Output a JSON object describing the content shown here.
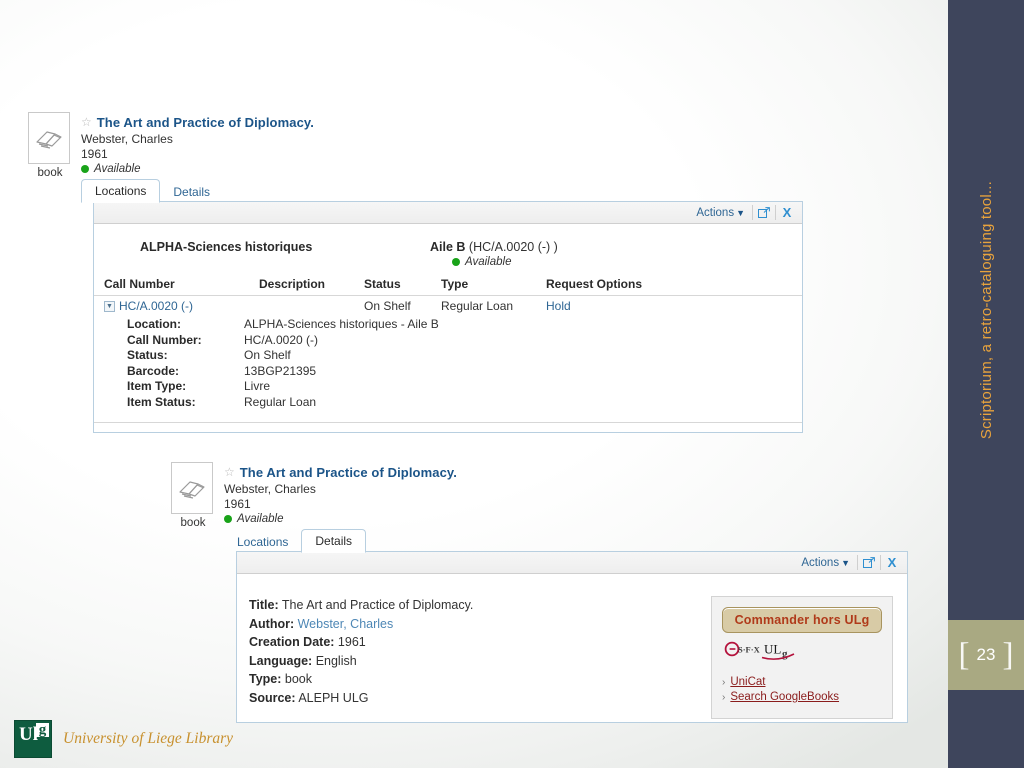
{
  "slide": {
    "vertical_title": "Scriptorium, a retro-cataloguing tool...",
    "page_number": "23",
    "bracket_left": "[",
    "bracket_right": "]",
    "footer_text": "University of Liege Library",
    "logo_letters": {
      "ul": "Ul",
      "g": "g"
    },
    "colors": {
      "sidebar": "#3e455c",
      "page_box": "#a9a982",
      "accent_orange": "#e8a33d",
      "footer_gold": "#c8912f",
      "link_blue": "#2f6694",
      "title_blue": "#1b5488",
      "available_green": "#19a319",
      "order_button_text": "#b03a1a"
    }
  },
  "record": {
    "thumb_label": "book",
    "thumb_icon": "open-book-icon",
    "star_icon": "star-outline-icon",
    "title": "The Art and Practice of Diplomacy.",
    "author": "Webster, Charles",
    "year": "1961",
    "availability": "Available"
  },
  "tabs": {
    "locations": "Locations",
    "details": "Details"
  },
  "toolbar": {
    "actions_label": "Actions",
    "chevron_icon": "chevron-down-icon",
    "popout_icon": "external-link-icon",
    "close_icon": "close-x-icon",
    "close_label": "X"
  },
  "locations_panel": {
    "library": "ALPHA-Sciences historiques",
    "wing_label": "Aile B",
    "wing_callno": "(HC/A.0020 (-) )",
    "wing_availability": "Available",
    "columns": [
      "Call Number",
      "Description",
      "Status",
      "Type",
      "Request Options"
    ],
    "row": {
      "expander_icon": "collapse-triangle-icon",
      "call_number": "HC/A.0020 (-)",
      "description": "",
      "status": "On Shelf",
      "type": "Regular Loan",
      "request_option": "Hold"
    },
    "item_details": [
      {
        "key": "Location:",
        "value": "ALPHA-Sciences historiques - Aile B"
      },
      {
        "key": "Call Number:",
        "value": "HC/A.0020 (-)"
      },
      {
        "key": "Status:",
        "value": "On Shelf"
      },
      {
        "key": "Barcode:",
        "value": "13BGP21395"
      },
      {
        "key": "Item Type:",
        "value": "Livre"
      },
      {
        "key": "Item Status:",
        "value": "Regular Loan"
      }
    ]
  },
  "details_panel": {
    "fields": [
      {
        "key": "Title:",
        "value": "The Art and Practice of Diplomacy.",
        "link": false
      },
      {
        "key": "Author:",
        "value": "Webster, Charles",
        "link": true
      },
      {
        "key": "Creation Date:",
        "value": "1961",
        "link": false
      },
      {
        "key": "Language:",
        "value": "English",
        "link": false
      },
      {
        "key": "Type:",
        "value": "book",
        "link": false
      },
      {
        "key": "Source:",
        "value": "ALEPH ULG",
        "link": false
      }
    ],
    "sidebar": {
      "order_button": "Commander hors ULg",
      "sfx_logo": "sfx-ulg-logo",
      "sfx_text": "S·F·X ULg",
      "links": [
        {
          "label": "UniCat"
        },
        {
          "label": "Search GoogleBooks"
        }
      ]
    }
  }
}
